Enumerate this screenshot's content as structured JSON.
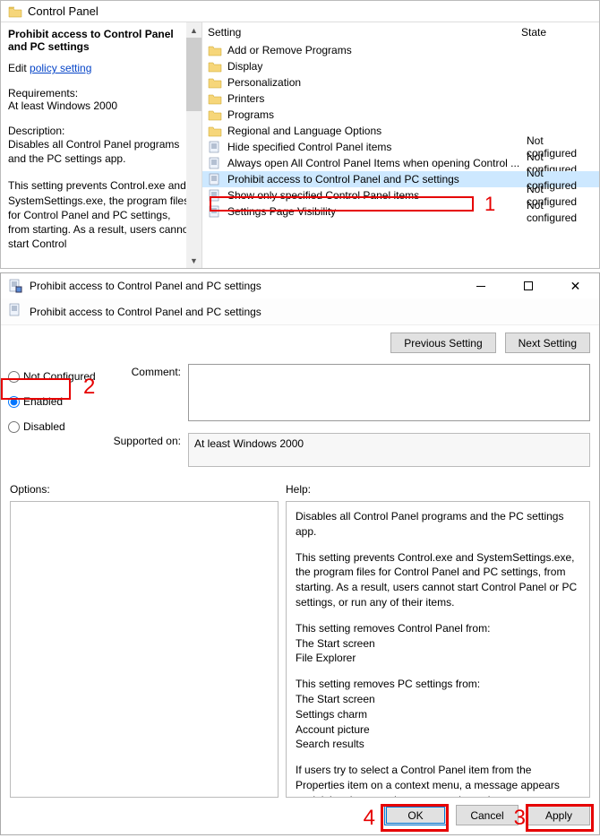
{
  "topPane": {
    "breadcrumb": "Control Panel",
    "leftPanel": {
      "title": "Prohibit access to Control Panel and PC settings",
      "editPrefix": "Edit ",
      "editLink": "policy setting",
      "reqHead": "Requirements:",
      "reqText": "At least Windows 2000",
      "descHead": "Description:",
      "descText": "Disables all Control Panel programs and the PC settings app.",
      "moreText": "This setting prevents Control.exe and SystemSettings.exe, the program files for Control Panel and PC settings, from starting. As a result, users cannot start Control"
    },
    "columns": {
      "setting": "Setting",
      "state": "State"
    },
    "rows": [
      {
        "type": "folder",
        "name": "Add or Remove Programs",
        "state": ""
      },
      {
        "type": "folder",
        "name": "Display",
        "state": ""
      },
      {
        "type": "folder",
        "name": "Personalization",
        "state": ""
      },
      {
        "type": "folder",
        "name": "Printers",
        "state": ""
      },
      {
        "type": "folder",
        "name": "Programs",
        "state": ""
      },
      {
        "type": "folder",
        "name": "Regional and Language Options",
        "state": ""
      },
      {
        "type": "policy",
        "name": "Hide specified Control Panel items",
        "state": "Not configured"
      },
      {
        "type": "policy",
        "name": "Always open All Control Panel Items when opening Control ...",
        "state": "Not configured"
      },
      {
        "type": "policy",
        "name": "Prohibit access to Control Panel and PC settings",
        "state": "Not configured",
        "selected": true
      },
      {
        "type": "policy",
        "name": "Show only specified Control Panel items",
        "state": "Not configured"
      },
      {
        "type": "policy",
        "name": "Settings Page Visibility",
        "state": "Not configured"
      }
    ],
    "annotation1": "1"
  },
  "dialog": {
    "title": "Prohibit access to Control Panel and PC settings",
    "subTitle": "Prohibit access to Control Panel and PC settings",
    "btnPrev": "Previous Setting",
    "btnNext": "Next Setting",
    "radios": {
      "notConfigured": "Not Configured",
      "enabled": "Enabled",
      "disabled": "Disabled",
      "selected": "enabled"
    },
    "commentLabel": "Comment:",
    "commentValue": "",
    "supportedLabel": "Supported on:",
    "supportedValue": "At least Windows 2000",
    "optionsLabel": "Options:",
    "helpLabel": "Help:",
    "helpParas": [
      "Disables all Control Panel programs and the PC settings app.",
      "This setting prevents Control.exe and SystemSettings.exe, the program files for Control Panel and PC settings, from starting. As a result, users cannot start Control Panel or PC settings, or run any of their items.",
      "This setting removes Control Panel from:\nThe Start screen\nFile Explorer",
      "This setting removes PC settings from:\nThe Start screen\nSettings charm\nAccount picture\nSearch results",
      "If users try to select a Control Panel item from the Properties item on a context menu, a message appears explaining that a setting prevents the action."
    ],
    "btnOK": "OK",
    "btnCancel": "Cancel",
    "btnApply": "Apply",
    "annotation2": "2",
    "annotation3": "3",
    "annotation4": "4"
  }
}
